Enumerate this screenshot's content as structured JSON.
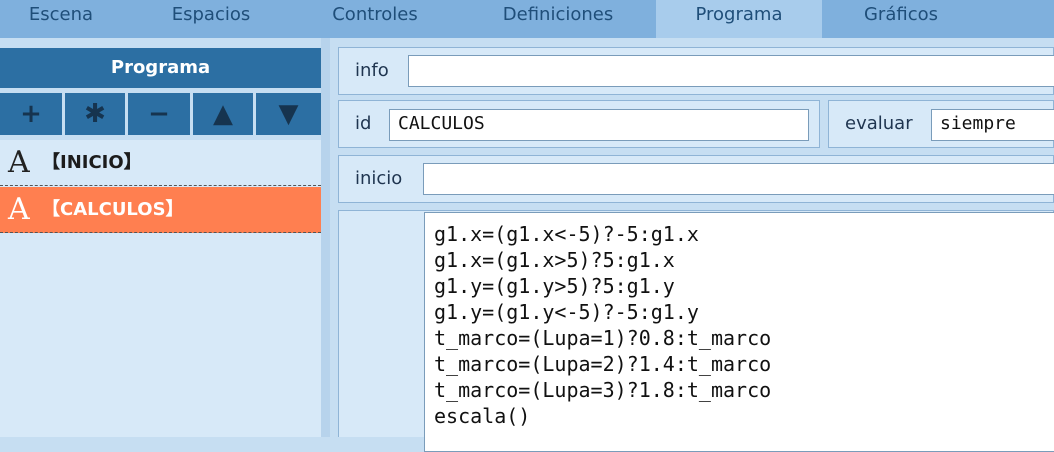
{
  "tabs": [
    {
      "label": "Escena"
    },
    {
      "label": "Espacios"
    },
    {
      "label": "Controles"
    },
    {
      "label": "Definiciones"
    },
    {
      "label": "Programa",
      "active": true
    },
    {
      "label": "Gráficos"
    }
  ],
  "left": {
    "title": "Programa",
    "toolbar": [
      "+",
      "✱",
      "−",
      "▲",
      "▼"
    ],
    "items": [
      {
        "glyph": "A",
        "label": "【INICIO】",
        "selected": false
      },
      {
        "glyph": "A",
        "label": "【CALCULOS】",
        "selected": true
      }
    ]
  },
  "form": {
    "info_label": "info",
    "info_value": "",
    "id_label": "id",
    "id_value": "CALCULOS",
    "evaluar_label": "evaluar",
    "evaluar_value": "siempre",
    "inicio_label": "inicio",
    "inicio_value": "",
    "code_lines": [
      "g1.x=(g1.x<-5)?-5:g1.x",
      "g1.x=(g1.x>5)?5:g1.x",
      "g1.y=(g1.y>5)?5:g1.y",
      "g1.y=(g1.y<-5)?-5:g1.y",
      "t_marco=(Lupa=1)?0.8:t_marco",
      "t_marco=(Lupa=2)?1.4:t_marco",
      "t_marco=(Lupa=3)?1.8:t_marco",
      "escala()"
    ]
  },
  "colors": {
    "accent": "#2c6fa3",
    "selected": "#ff7f50",
    "tabbar": "#7fb0dd"
  }
}
